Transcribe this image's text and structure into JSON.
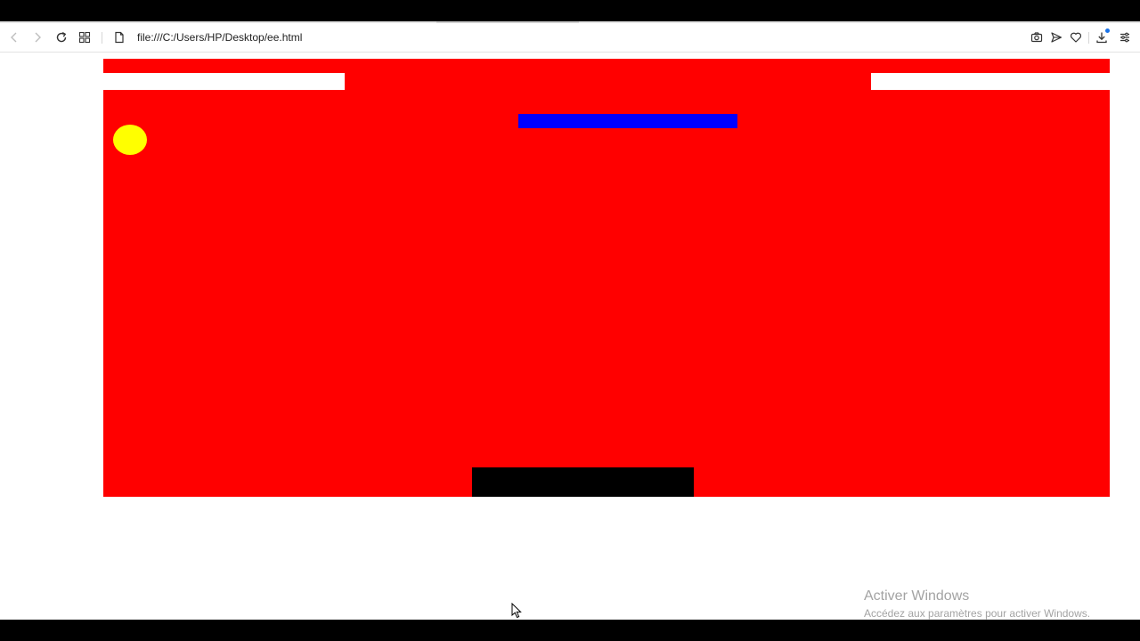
{
  "browser": {
    "address_bar": {
      "url": "file:///C:/Users/HP/Desktop/ee.html",
      "page_icon": "page-icon"
    },
    "nav_icons": [
      "back-icon",
      "forward-icon",
      "reload-icon",
      "apps-grid-icon"
    ],
    "toolbar_icons": [
      "camera-icon",
      "send-icon",
      "heart-icon",
      "download-icon",
      "menu-icon"
    ]
  },
  "game": {
    "colors": {
      "background": "#ff0000",
      "bricks": "#ffffff",
      "bar": "#0000ff",
      "ball": "#ffff00",
      "paddle": "#000000"
    }
  },
  "watermark": {
    "title": "Activer Windows",
    "subtitle": "Accédez aux paramètres pour activer Windows."
  }
}
